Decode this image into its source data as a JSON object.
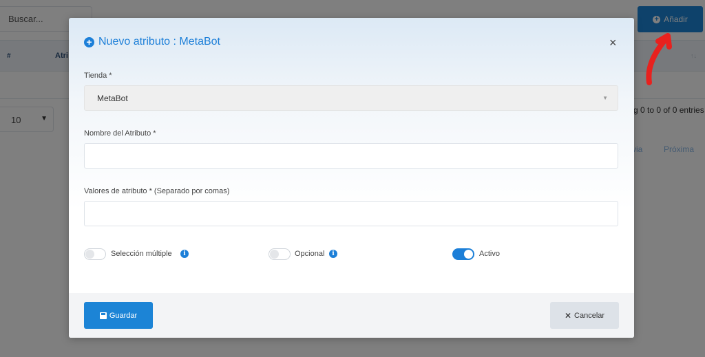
{
  "background": {
    "search_placeholder": "Buscar...",
    "add_button": "Añadir",
    "table_headers": {
      "hash": "#",
      "attr": "Atri",
      "sort": "↑↓"
    },
    "page_size": "10",
    "entries_text": "g 0 to 0 of 0 entries",
    "prev_label": "via",
    "next_label": "Próxima"
  },
  "modal": {
    "title": "Nuevo atributo : MetaBot",
    "close": "×",
    "store_label": "Tienda *",
    "store_value": "MetaBot",
    "name_label": "Nombre del Atributo *",
    "name_value": "",
    "values_label": "Valores de atributo * (Separado por comas)",
    "values_value": "",
    "toggles": {
      "multiple": {
        "label": "Selección múltiple",
        "on": false
      },
      "optional": {
        "label": "Opcional",
        "on": false
      },
      "active": {
        "label": "Activo",
        "on": true
      }
    },
    "save_label": "Guardar",
    "cancel_label": "Cancelar"
  },
  "colors": {
    "accent": "#1c84d6",
    "annotation": "#e8211e"
  }
}
